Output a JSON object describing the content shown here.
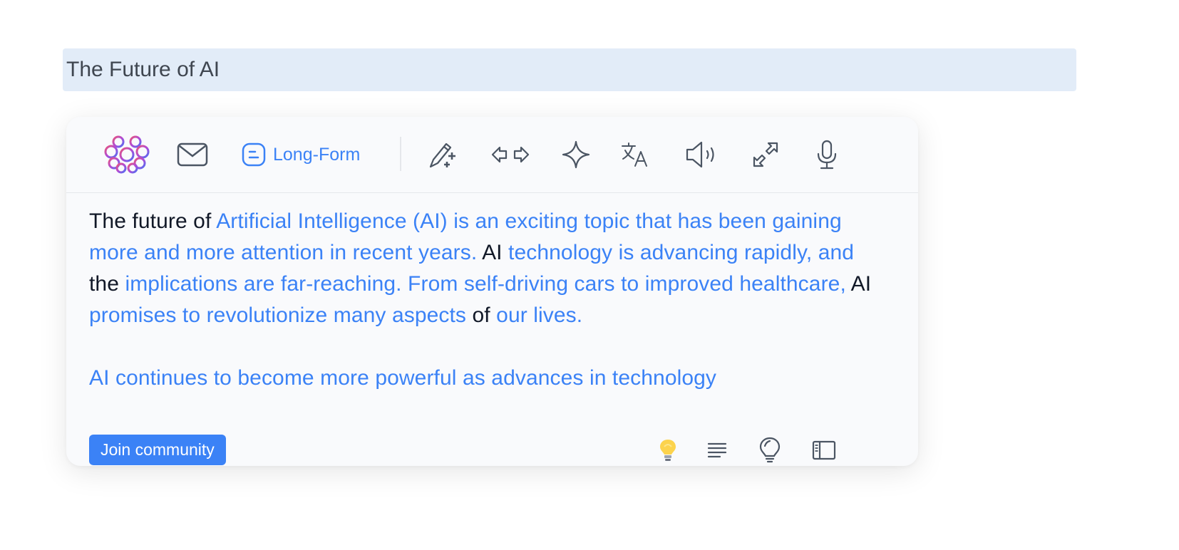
{
  "document": {
    "title": "The Future of AI"
  },
  "toolbar": {
    "logo_icon": "brain-logo-icon",
    "email_icon": "envelope-icon",
    "mode_label": "Long-Form",
    "mode_icon": "blog-icon",
    "tools": [
      "magic-pen-icon",
      "arrows-left-right-icon",
      "sparkle-icon",
      "translate-icon",
      "speaker-icon",
      "expand-arrows-icon",
      "microphone-icon"
    ]
  },
  "content": {
    "p1": {
      "s1": "The future of ",
      "s2": "Artificial Intelligence (AI) is an exciting topic that has been gaining more and more attention in recent years. ",
      "s3": "AI",
      "s4": " technology is advancing rapidly, and ",
      "s5": "the",
      "s6": " implications are far-reaching. From self-driving cars to improved healthcare, ",
      "s7": "AI",
      "s8": " promises to revolutionize many aspects ",
      "s9": "of",
      "s10": " our lives."
    },
    "p2": "AI continues to become more powerful as advances in technology"
  },
  "footer": {
    "join_label": "Join community",
    "icons": [
      "lightbulb-icon",
      "align-text-icon",
      "idea-icon",
      "sidebar-icon"
    ]
  },
  "colors": {
    "accent": "#3b82f6",
    "title_bg": "#e2ecf8",
    "panel_bg": "#f9fafc",
    "text_dark": "#111827"
  }
}
